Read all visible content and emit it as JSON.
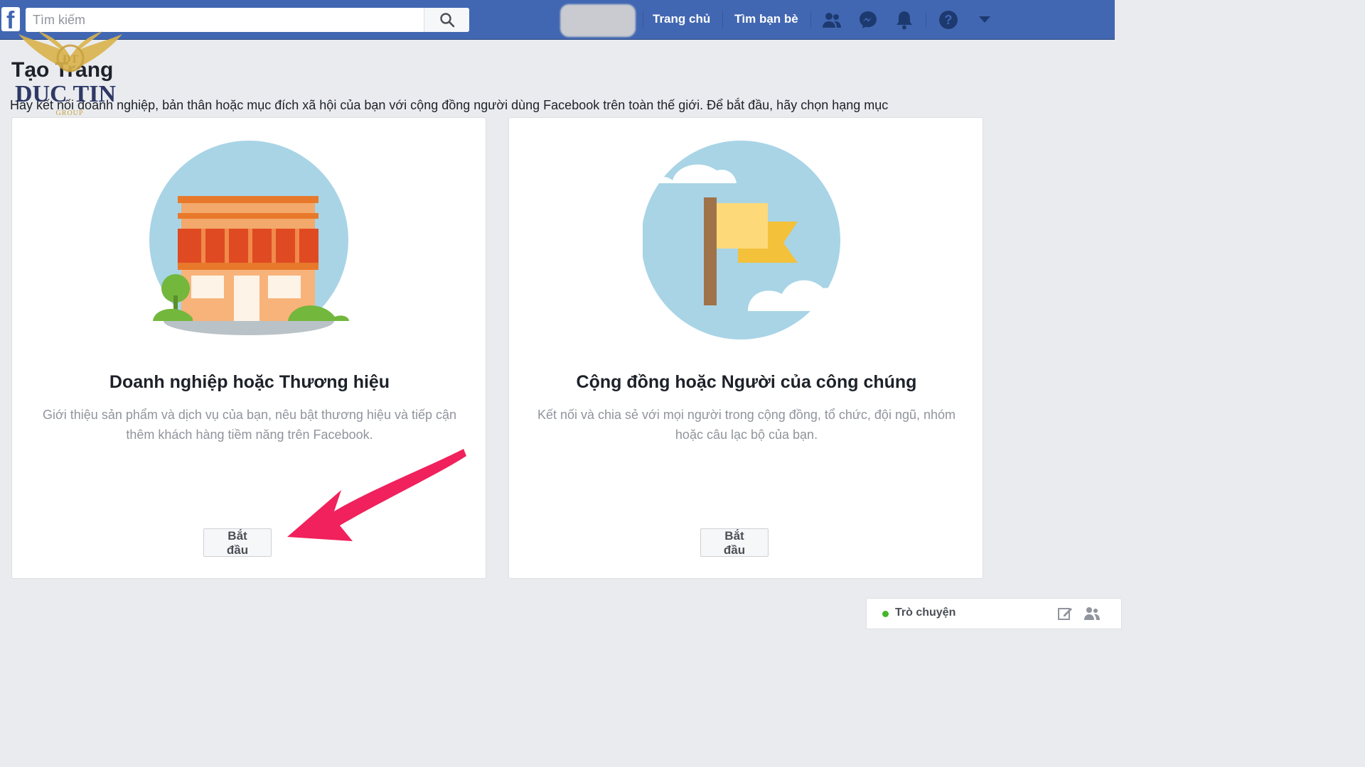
{
  "topbar": {
    "search_placeholder": "Tìm kiếm",
    "nav_home": "Trang chủ",
    "nav_find_friends": "Tìm bạn bè",
    "icons": [
      "friend-requests-icon",
      "messenger-icon",
      "notifications-icon",
      "help-icon",
      "dropdown-arrow-icon"
    ],
    "brand_color": "#4267b2"
  },
  "page": {
    "title": "Tạo Trang",
    "description": "Hãy kết nối doanh nghiệp, bản thân hoặc mục đích xã hội của bạn với cộng đồng người dùng Facebook trên toàn thế giới. Để bắt đầu, hãy chọn hạng mục"
  },
  "watermark": {
    "text": "DUC TIN",
    "sub": "GROUP"
  },
  "cards": [
    {
      "title": "Doanh nghiệp hoặc Thương hiệu",
      "description": "Giới thiệu sản phẩm và dịch vụ của bạn, nêu bật thương hiệu và tiếp cận thêm khách hàng tiềm năng trên Facebook.",
      "button": "Bắt đầu",
      "illustration": "storefront-illustration"
    },
    {
      "title": "Cộng đồng hoặc Người của công chúng",
      "description": "Kết nối và chia sẻ với mọi người trong cộng đồng, tổ chức, đội ngũ, nhóm hoặc câu lạc bộ của bạn.",
      "button": "Bắt đầu",
      "illustration": "flag-illustration"
    }
  ],
  "chat": {
    "label": "Trò chuyện",
    "status_color": "#42b72a"
  }
}
